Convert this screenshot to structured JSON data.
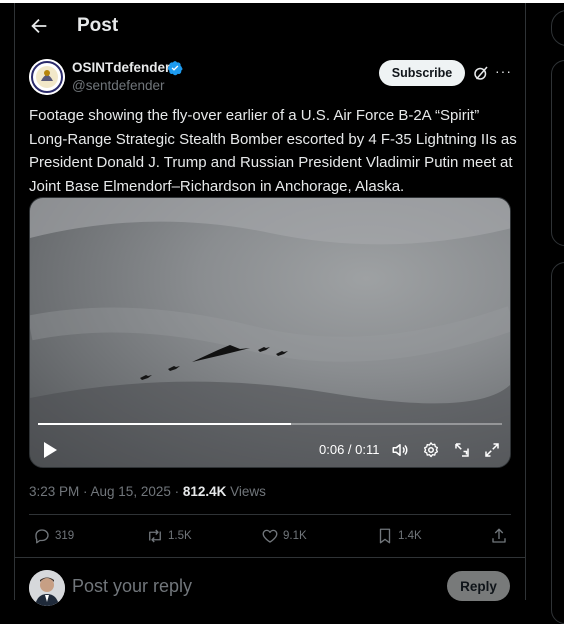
{
  "header": {
    "title": "Post"
  },
  "author": {
    "name": "OSINTdefender",
    "handle": "@sentdefender"
  },
  "actions": {
    "subscribe_label": "Subscribe"
  },
  "tweet": {
    "text": "Footage showing the fly-over earlier of a U.S. Air Force B-2A “Spirit” Long-Range Strategic Stealth Bomber escorted by 4 F-35 Lightning IIs as President Donald J. Trump and Russian President Vladimir Putin meet at Joint Base Elmendorf–Richardson in Anchorage, Alaska."
  },
  "video": {
    "time": "0:06 / 0:11",
    "progress": 0.545
  },
  "meta": {
    "timestamp": "3:23 PM · Aug 15, 2025 · ",
    "views_count": "812.4K",
    "views_label": " Views"
  },
  "engagement": {
    "replies": "319",
    "reposts": "1.5K",
    "likes": "9.1K",
    "bookmarks": "1.4K"
  },
  "reply": {
    "placeholder": "Post your reply",
    "button_label": "Reply"
  },
  "colors": {
    "background": "#000000",
    "text": "#e7e9ea",
    "muted": "#71767b",
    "verified": "#1d9bf0",
    "border": "#2f3336"
  }
}
